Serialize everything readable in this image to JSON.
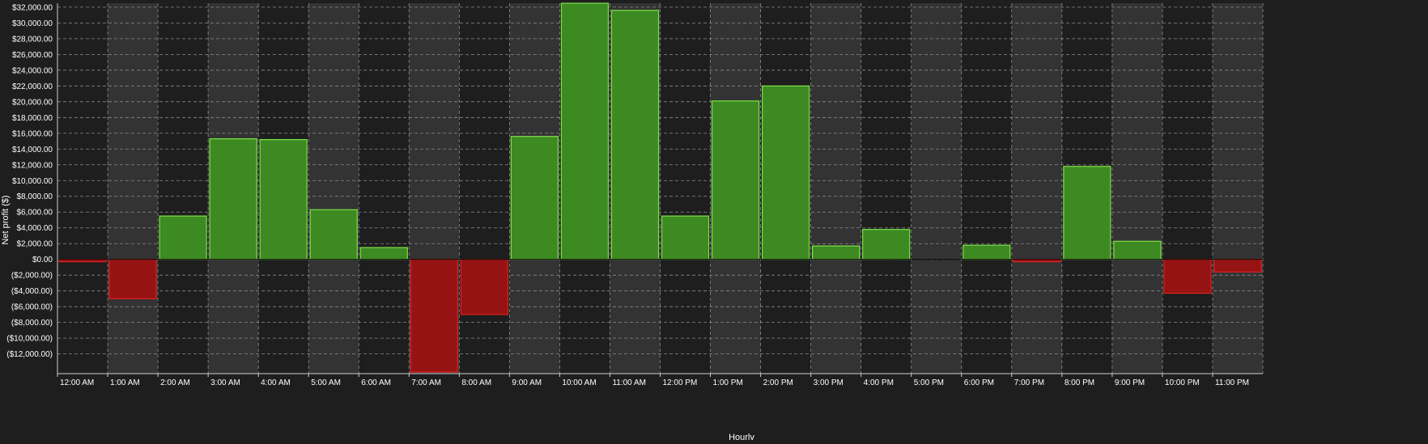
{
  "chart_data": {
    "type": "bar",
    "title": "",
    "xlabel": "Hourly",
    "ylabel": "Net profit ($)",
    "ylim": [
      -14500,
      32500
    ],
    "yticks": [
      32000,
      30000,
      28000,
      26000,
      24000,
      22000,
      20000,
      18000,
      16000,
      14000,
      12000,
      10000,
      8000,
      6000,
      4000,
      2000,
      0,
      -2000,
      -4000,
      -6000,
      -8000,
      -10000,
      -12000
    ],
    "ytick_labels": [
      "$32,000.00",
      "$30,000.00",
      "$28,000.00",
      "$26,000.00",
      "$24,000.00",
      "$22,000.00",
      "$20,000.00",
      "$18,000.00",
      "$16,000.00",
      "$14,000.00",
      "$12,000.00",
      "$10,000.00",
      "$8,000.00",
      "$6,000.00",
      "$4,000.00",
      "$2,000.00",
      "$0.00",
      "($2,000.00)",
      "($4,000.00)",
      "($6,000.00)",
      "($8,000.00)",
      "($10,000.00)",
      "($12,000.00)"
    ],
    "categories": [
      "12:00 AM",
      "1:00 AM",
      "2:00 AM",
      "3:00 AM",
      "4:00 AM",
      "5:00 AM",
      "6:00 AM",
      "7:00 AM",
      "8:00 AM",
      "9:00 AM",
      "10:00 AM",
      "11:00 AM",
      "12:00 PM",
      "1:00 PM",
      "2:00 PM",
      "3:00 PM",
      "4:00 PM",
      "5:00 PM",
      "6:00 PM",
      "7:00 PM",
      "8:00 PM",
      "9:00 PM",
      "10:00 PM",
      "11:00 PM"
    ],
    "values": [
      -300,
      -5000,
      5500,
      15300,
      15200,
      6300,
      1500,
      -14300,
      -7000,
      15600,
      32500,
      31600,
      5500,
      20100,
      22000,
      1700,
      3800,
      0,
      1800,
      -300,
      11800,
      2300,
      -4300,
      -1600
    ],
    "grid": true,
    "legend": "none",
    "colors": {
      "background": "#1e1e1e",
      "band_light": "#333333",
      "band_dark": "#1e1e1e",
      "grid": "#8a8a8a",
      "text": "#ffffff",
      "positive_fill": "#3d8a22",
      "positive_stroke": "#7fe04a",
      "negative_fill": "#961313",
      "negative_stroke": "#e02222",
      "axis": "#cfcfcf"
    }
  }
}
